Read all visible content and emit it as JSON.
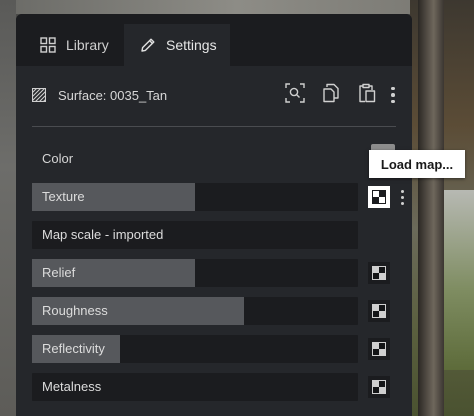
{
  "tabs": [
    {
      "label": "Library",
      "icon": "grid-icon"
    },
    {
      "label": "Settings",
      "icon": "pencil-icon",
      "active": true
    }
  ],
  "surface": {
    "label": "Surface: 0035_Tan",
    "icon": "hatch-icon",
    "actions": [
      "find-icon",
      "copy-icon",
      "paste-icon",
      "more-icon"
    ]
  },
  "color": {
    "label": "Color",
    "swatch": "#8d8d8d"
  },
  "tooltip": "Load map...",
  "rows": [
    {
      "label": "Texture",
      "fill": 0.5,
      "map_active": true
    },
    {
      "label": "Map scale - imported",
      "fill": 0.0
    },
    {
      "label": "Relief",
      "fill": 0.5
    },
    {
      "label": "Roughness",
      "fill": 0.65
    },
    {
      "label": "Reflectivity",
      "fill": 0.27
    },
    {
      "label": "Metalness",
      "fill": 0.0
    }
  ]
}
